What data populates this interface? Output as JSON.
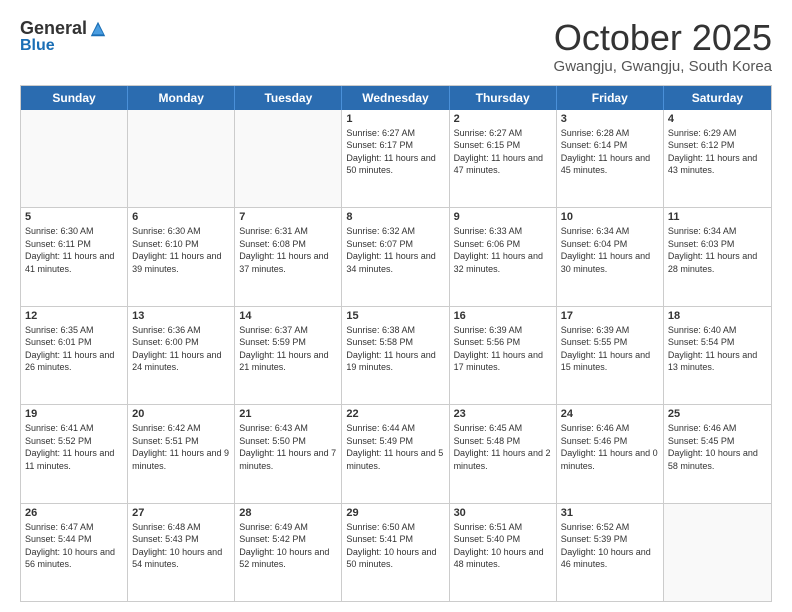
{
  "header": {
    "logo_general": "General",
    "logo_blue": "Blue",
    "month_title": "October 2025",
    "location": "Gwangju, Gwangju, South Korea"
  },
  "days_of_week": [
    "Sunday",
    "Monday",
    "Tuesday",
    "Wednesday",
    "Thursday",
    "Friday",
    "Saturday"
  ],
  "weeks": [
    [
      {
        "day": "",
        "empty": true
      },
      {
        "day": "",
        "empty": true
      },
      {
        "day": "",
        "empty": true
      },
      {
        "day": "1",
        "sunrise": "6:27 AM",
        "sunset": "6:17 PM",
        "daylight": "11 hours and 50 minutes."
      },
      {
        "day": "2",
        "sunrise": "6:27 AM",
        "sunset": "6:15 PM",
        "daylight": "11 hours and 47 minutes."
      },
      {
        "day": "3",
        "sunrise": "6:28 AM",
        "sunset": "6:14 PM",
        "daylight": "11 hours and 45 minutes."
      },
      {
        "day": "4",
        "sunrise": "6:29 AM",
        "sunset": "6:12 PM",
        "daylight": "11 hours and 43 minutes."
      }
    ],
    [
      {
        "day": "5",
        "sunrise": "6:30 AM",
        "sunset": "6:11 PM",
        "daylight": "11 hours and 41 minutes."
      },
      {
        "day": "6",
        "sunrise": "6:30 AM",
        "sunset": "6:10 PM",
        "daylight": "11 hours and 39 minutes."
      },
      {
        "day": "7",
        "sunrise": "6:31 AM",
        "sunset": "6:08 PM",
        "daylight": "11 hours and 37 minutes."
      },
      {
        "day": "8",
        "sunrise": "6:32 AM",
        "sunset": "6:07 PM",
        "daylight": "11 hours and 34 minutes."
      },
      {
        "day": "9",
        "sunrise": "6:33 AM",
        "sunset": "6:06 PM",
        "daylight": "11 hours and 32 minutes."
      },
      {
        "day": "10",
        "sunrise": "6:34 AM",
        "sunset": "6:04 PM",
        "daylight": "11 hours and 30 minutes."
      },
      {
        "day": "11",
        "sunrise": "6:34 AM",
        "sunset": "6:03 PM",
        "daylight": "11 hours and 28 minutes."
      }
    ],
    [
      {
        "day": "12",
        "sunrise": "6:35 AM",
        "sunset": "6:01 PM",
        "daylight": "11 hours and 26 minutes."
      },
      {
        "day": "13",
        "sunrise": "6:36 AM",
        "sunset": "6:00 PM",
        "daylight": "11 hours and 24 minutes."
      },
      {
        "day": "14",
        "sunrise": "6:37 AM",
        "sunset": "5:59 PM",
        "daylight": "11 hours and 21 minutes."
      },
      {
        "day": "15",
        "sunrise": "6:38 AM",
        "sunset": "5:58 PM",
        "daylight": "11 hours and 19 minutes."
      },
      {
        "day": "16",
        "sunrise": "6:39 AM",
        "sunset": "5:56 PM",
        "daylight": "11 hours and 17 minutes."
      },
      {
        "day": "17",
        "sunrise": "6:39 AM",
        "sunset": "5:55 PM",
        "daylight": "11 hours and 15 minutes."
      },
      {
        "day": "18",
        "sunrise": "6:40 AM",
        "sunset": "5:54 PM",
        "daylight": "11 hours and 13 minutes."
      }
    ],
    [
      {
        "day": "19",
        "sunrise": "6:41 AM",
        "sunset": "5:52 PM",
        "daylight": "11 hours and 11 minutes."
      },
      {
        "day": "20",
        "sunrise": "6:42 AM",
        "sunset": "5:51 PM",
        "daylight": "11 hours and 9 minutes."
      },
      {
        "day": "21",
        "sunrise": "6:43 AM",
        "sunset": "5:50 PM",
        "daylight": "11 hours and 7 minutes."
      },
      {
        "day": "22",
        "sunrise": "6:44 AM",
        "sunset": "5:49 PM",
        "daylight": "11 hours and 5 minutes."
      },
      {
        "day": "23",
        "sunrise": "6:45 AM",
        "sunset": "5:48 PM",
        "daylight": "11 hours and 2 minutes."
      },
      {
        "day": "24",
        "sunrise": "6:46 AM",
        "sunset": "5:46 PM",
        "daylight": "11 hours and 0 minutes."
      },
      {
        "day": "25",
        "sunrise": "6:46 AM",
        "sunset": "5:45 PM",
        "daylight": "10 hours and 58 minutes."
      }
    ],
    [
      {
        "day": "26",
        "sunrise": "6:47 AM",
        "sunset": "5:44 PM",
        "daylight": "10 hours and 56 minutes."
      },
      {
        "day": "27",
        "sunrise": "6:48 AM",
        "sunset": "5:43 PM",
        "daylight": "10 hours and 54 minutes."
      },
      {
        "day": "28",
        "sunrise": "6:49 AM",
        "sunset": "5:42 PM",
        "daylight": "10 hours and 52 minutes."
      },
      {
        "day": "29",
        "sunrise": "6:50 AM",
        "sunset": "5:41 PM",
        "daylight": "10 hours and 50 minutes."
      },
      {
        "day": "30",
        "sunrise": "6:51 AM",
        "sunset": "5:40 PM",
        "daylight": "10 hours and 48 minutes."
      },
      {
        "day": "31",
        "sunrise": "6:52 AM",
        "sunset": "5:39 PM",
        "daylight": "10 hours and 46 minutes."
      },
      {
        "day": "",
        "empty": true
      }
    ]
  ]
}
